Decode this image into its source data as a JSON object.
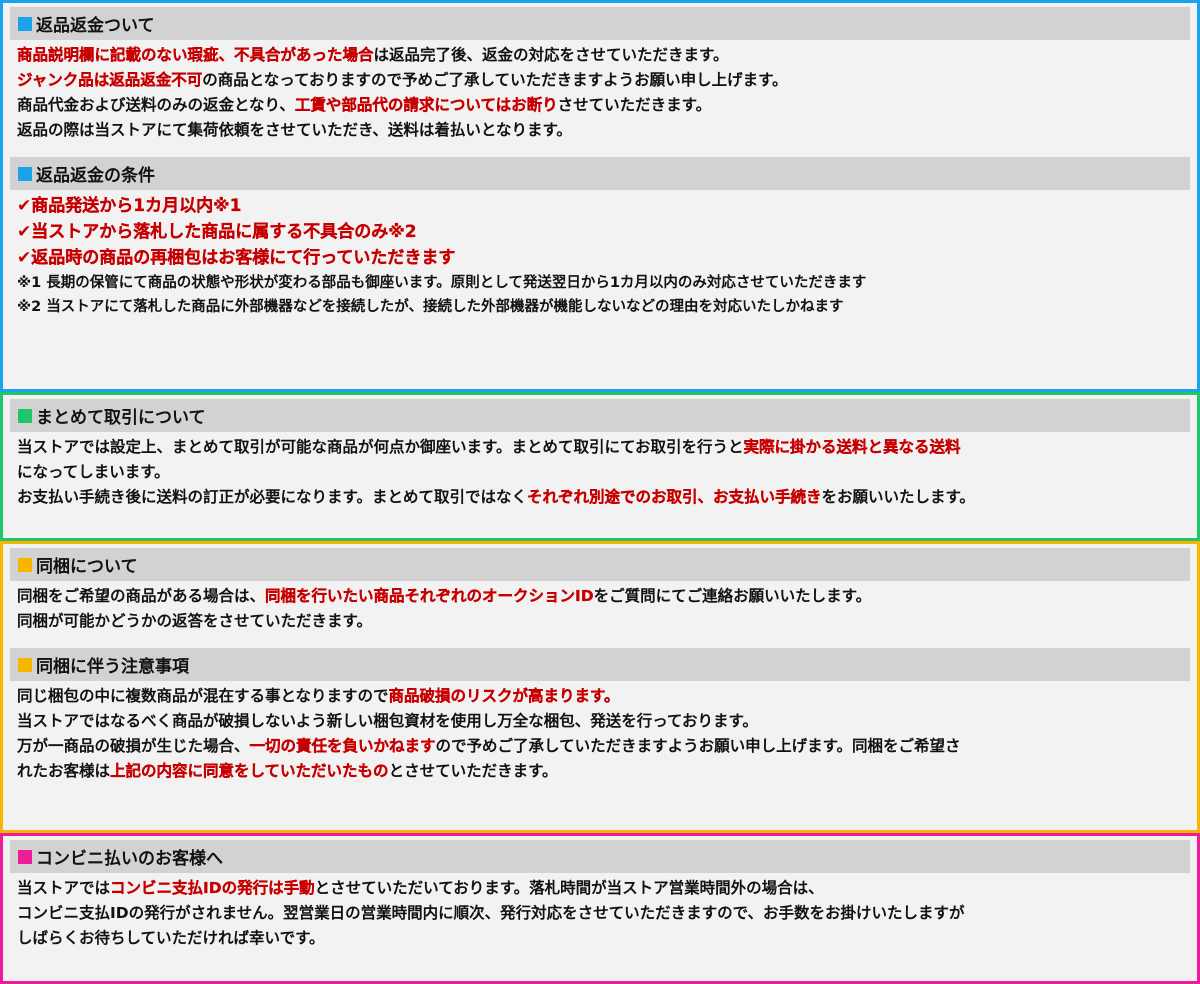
{
  "colors": {
    "blue": "#1aa3e8",
    "green": "#21c46a",
    "orange": "#f7b500",
    "pink": "#ee1c96",
    "highlight": "#c60000",
    "header_bg": "#d2d2d2",
    "panel_bg": "#f2f2f2"
  },
  "check_icon": "✔",
  "returns": {
    "title": "返品返金ついて",
    "lines": [
      [
        {
          "t": "商品説明欄に記載のない瑕疵、不具合があった場合",
          "hl": true
        },
        {
          "t": "は返品完了後、返金の対応をさせていただきます。"
        }
      ],
      [
        {
          "t": "ジャンク品は返品返金不可",
          "hl": true
        },
        {
          "t": "の商品となっておりますので予めご了承していただきますようお願い申し上げます。"
        }
      ],
      [
        {
          "t": "商品代金および送料のみの返金となり、"
        },
        {
          "t": "工賃や部品代の請求についてはお断り",
          "hl": true
        },
        {
          "t": "させていただきます。"
        }
      ],
      [
        {
          "t": "返品の際は当ストアにて集荷依頼をさせていただき、送料は着払いとなります。"
        }
      ]
    ]
  },
  "conditions": {
    "title": "返品返金の条件",
    "items": [
      "商品発送から1カ月以内※1",
      "当ストアから落札した商品に属する不具合のみ※2",
      "返品時の商品の再梱包はお客様にて行っていただきます"
    ],
    "notes": [
      "※1 長期の保管にて商品の状態や形状が変わる部品も御座います。原則として発送翌日から1カ月以内のみ対応させていただきます",
      "※2 当ストアにて落札した商品に外部機器などを接続したが、接続した外部機器が機能しないなどの理由を対応いたしかねます"
    ]
  },
  "combined": {
    "title": "まとめて取引について",
    "lines": [
      [
        {
          "t": "当ストアでは設定上、まとめて取引が可能な商品が何点か御座います。まとめて取引にてお取引を行うと"
        },
        {
          "t": "実際に掛かる送料と異なる送料",
          "hl": true
        }
      ],
      [
        {
          "t": "になってしまいます。"
        }
      ],
      [
        {
          "t": "お支払い手続き後に送料の訂正が必要になります。まとめて取引ではなく"
        },
        {
          "t": "それぞれ別途でのお取引、お支払い手続き",
          "hl": true
        },
        {
          "t": "をお願いいたします。"
        }
      ]
    ]
  },
  "bundling": {
    "title": "同梱について",
    "lines": [
      [
        {
          "t": "同梱をご希望の商品がある場合は、"
        },
        {
          "t": "同梱を行いたい商品それぞれのオークションID",
          "hl": true
        },
        {
          "t": "をご質問にてご連絡お願いいたします。"
        }
      ],
      [
        {
          "t": "同梱が可能かどうかの返答をさせていただきます。"
        }
      ]
    ]
  },
  "bundling_notes": {
    "title": "同梱に伴う注意事項",
    "lines": [
      [
        {
          "t": "同じ梱包の中に複数商品が混在する事となりますので"
        },
        {
          "t": "商品破損のリスクが高まります。",
          "hl": true
        }
      ],
      [
        {
          "t": "当ストアではなるべく商品が破損しないよう新しい梱包資材を使用し万全な梱包、発送を行っております。"
        }
      ],
      [
        {
          "t": "万が一商品の破損が生じた場合、"
        },
        {
          "t": "一切の責任を負いかねます",
          "hl": true
        },
        {
          "t": "ので予めご了承していただきますようお願い申し上げます。同梱をご希望さ"
        }
      ],
      [
        {
          "t": "れたお客様は"
        },
        {
          "t": "上記の内容に同意をしていただいたもの",
          "hl": true
        },
        {
          "t": "とさせていただきます。"
        }
      ]
    ]
  },
  "convenience": {
    "title": "コンビニ払いのお客様へ",
    "lines": [
      [
        {
          "t": "当ストアでは"
        },
        {
          "t": "コンビニ支払IDの発行は手動",
          "hl": true
        },
        {
          "t": "とさせていただいております。落札時間が当ストア営業時間外の場合は、"
        }
      ],
      [
        {
          "t": "コンビニ支払IDの発行がされません。翌営業日の営業時間内に順次、発行対応をさせていただきますので、お手数をお掛けいたしますが"
        }
      ],
      [
        {
          "t": "しばらくお待ちしていただければ幸いです。"
        }
      ]
    ]
  }
}
